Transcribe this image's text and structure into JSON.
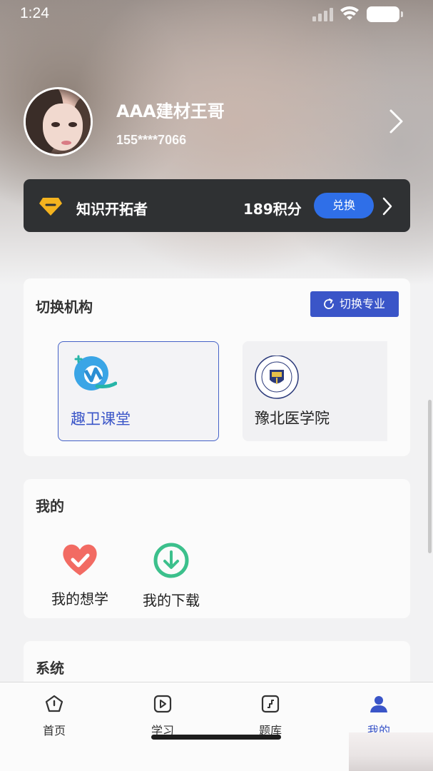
{
  "status_bar": {
    "time": "1:24"
  },
  "profile": {
    "username": "AAA建材王哥",
    "phone": "155****7066"
  },
  "vip": {
    "title": "知识开拓者",
    "points": "189积分",
    "exchange_label": "兑换",
    "accent": "#2f6fe8"
  },
  "institution": {
    "title": "切换机构",
    "switch_label": "切换专业",
    "orgs": [
      {
        "name": "趣卫课堂",
        "selected": true
      },
      {
        "name": "豫北医学院",
        "selected": false
      }
    ]
  },
  "mine": {
    "title": "我的",
    "items": [
      {
        "label": "我的想学",
        "icon": "heart-check-icon"
      },
      {
        "label": "我的下载",
        "icon": "download-icon"
      }
    ]
  },
  "system": {
    "title": "系统"
  },
  "tabbar": {
    "tabs": [
      {
        "label": "首页",
        "icon": "home-icon"
      },
      {
        "label": "学习",
        "icon": "play-icon"
      },
      {
        "label": "题库",
        "icon": "question-bank-icon"
      },
      {
        "label": "我的",
        "icon": "user-icon",
        "active": true
      }
    ]
  },
  "colors": {
    "primary": "#3a55c8",
    "vip_bg": "#2f3133"
  }
}
